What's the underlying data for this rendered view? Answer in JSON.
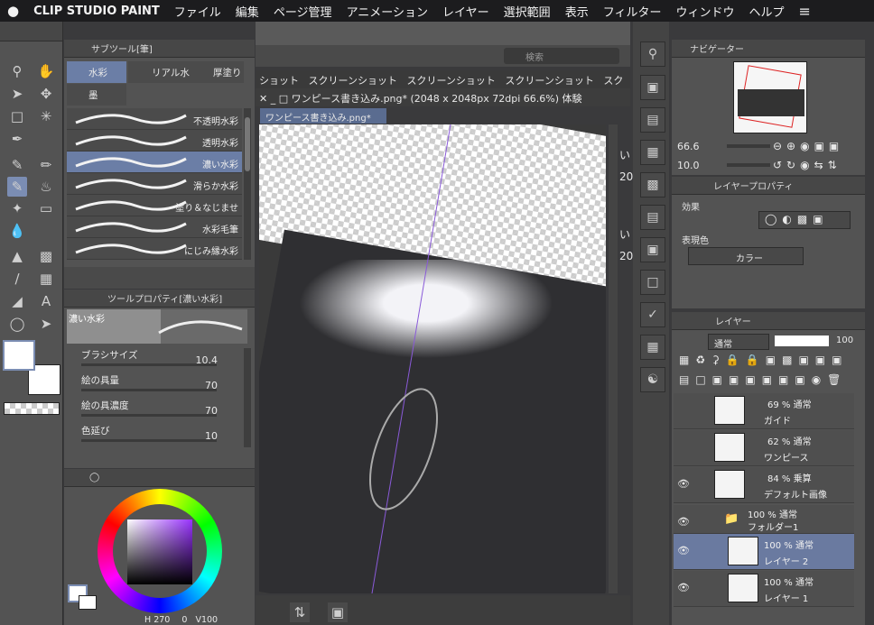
{
  "menubar": {
    "apple": "",
    "app": "CLIP STUDIO PAINT",
    "items": [
      "ファイル",
      "編集",
      "ページ管理",
      "アニメーション",
      "レイヤー",
      "選択範囲",
      "表示",
      "フィルター",
      "ウィンドウ",
      "ヘルプ"
    ],
    "list_icon": "≡"
  },
  "subtool": {
    "title": "サブツール[筆]",
    "tabs": [
      "水彩",
      "リアル水",
      "厚塗り",
      "墨"
    ],
    "brushes": [
      "不透明水彩",
      "透明水彩",
      "濃い水彩",
      "滑らか水彩",
      "塗り＆なじませ",
      "水彩毛筆",
      "にじみ縁水彩"
    ],
    "selected_index": 2
  },
  "toolprop": {
    "title": "ツールプロパティ[濃い水彩]",
    "preview_name": "濃い水彩",
    "props": [
      {
        "label": "ブラシサイズ",
        "value": "10.4"
      },
      {
        "label": "絵の具量",
        "value": "70"
      },
      {
        "label": "絵の具濃度",
        "value": "70"
      },
      {
        "label": "色延び",
        "value": "10"
      }
    ]
  },
  "color": {
    "hue": "270",
    "sat": "0",
    "val": "100",
    "h_label": "H",
    "v_label": "V"
  },
  "canvas": {
    "search_placeholder": "検索",
    "tabs": [
      "ショット",
      "スクリーンショット",
      "スクリーンショット",
      "スクリーンショット",
      "スク"
    ],
    "file_title": "ワンピース書き込み.png* (2048 x 2048px 72dpi 66.6%)",
    "file_tag": "体験",
    "tab_label": "ワンピース書き込み.png*",
    "right_clip": [
      "い",
      "20",
      "い",
      "20"
    ]
  },
  "navigator": {
    "title": "ナビゲーター",
    "zoom": "66.6",
    "rotate": "10.0"
  },
  "layerprop": {
    "title": "レイヤープロパティ",
    "effect_label": "効果",
    "color_label": "表現色",
    "color_value": "カラー"
  },
  "layers": {
    "title": "レイヤー",
    "blend": "通常",
    "opacity": "100",
    "items": [
      {
        "opacity": "69 % 通常",
        "name": "ガイド"
      },
      {
        "opacity": "62 % 通常",
        "name": "ワンピース"
      },
      {
        "opacity": "84 % 乗算",
        "name": "デフォルト画像"
      },
      {
        "opacity": "100 % 通常",
        "name": "フォルダー1"
      },
      {
        "opacity": "100 % 通常",
        "name": "レイヤー 2"
      },
      {
        "opacity": "100 % 通常",
        "name": "レイヤー 1"
      }
    ]
  },
  "colors": {
    "accent": "#6b7ea6",
    "menubar": "#1c1c1e",
    "panel": "#535353"
  }
}
